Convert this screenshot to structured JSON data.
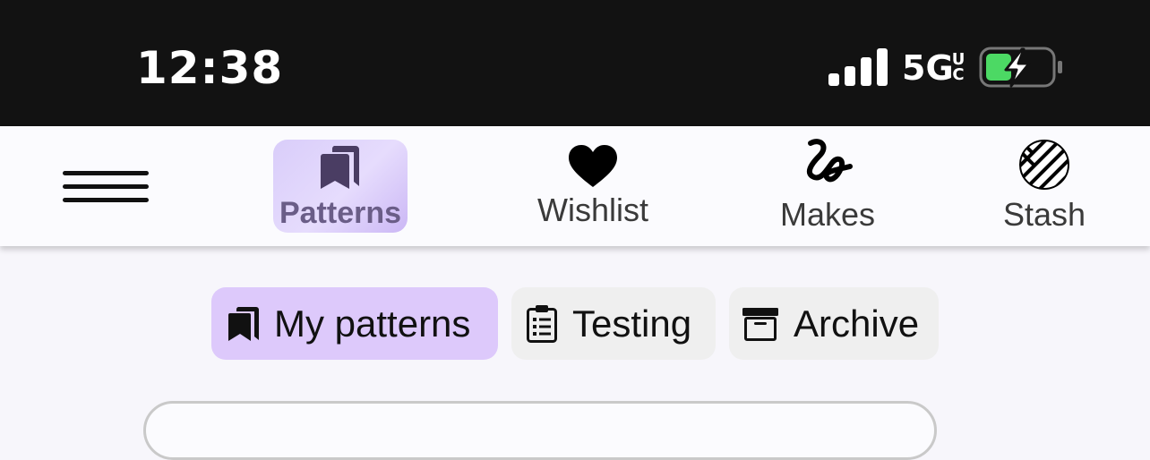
{
  "status_bar": {
    "time": "12:38",
    "network": "5G",
    "network_sup": "UC",
    "battery_color": "#4cd964"
  },
  "nav": {
    "menu_icon": "hamburger-icon",
    "items": [
      {
        "label": "Patterns",
        "icon": "bookmarks-icon",
        "active": true
      },
      {
        "label": "Wishlist",
        "icon": "heart-icon",
        "active": false
      },
      {
        "label": "Makes",
        "icon": "yarn-squiggle-icon",
        "active": false
      },
      {
        "label": "Stash",
        "icon": "yarn-ball-icon",
        "active": false
      }
    ]
  },
  "tabs": [
    {
      "label": "My patterns",
      "icon": "bookmarks-icon",
      "active": true
    },
    {
      "label": "Testing",
      "icon": "clipboard-list-icon",
      "active": false
    },
    {
      "label": "Archive",
      "icon": "archive-box-icon",
      "active": false
    }
  ],
  "colors": {
    "accent": "#ddc9fb",
    "status_bar_bg": "#121212",
    "tab_bg": "#efefef"
  }
}
